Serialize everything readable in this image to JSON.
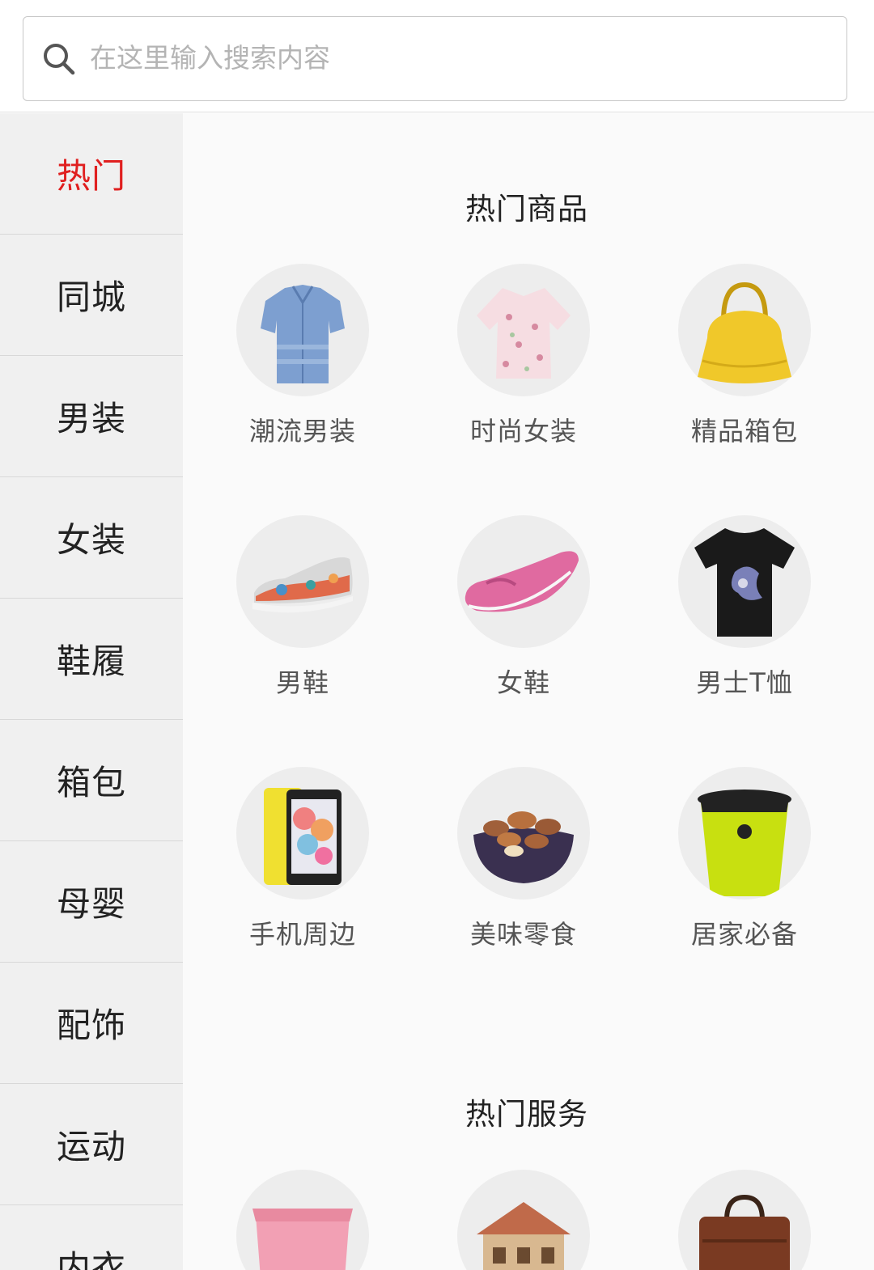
{
  "search": {
    "placeholder": "在这里输入搜索内容",
    "icon": "search-icon"
  },
  "sidebar": {
    "active_color": "#e02020",
    "items": [
      {
        "label": "热门"
      },
      {
        "label": "同城"
      },
      {
        "label": "男装"
      },
      {
        "label": "女装"
      },
      {
        "label": "鞋履"
      },
      {
        "label": "箱包"
      },
      {
        "label": "母婴"
      },
      {
        "label": "配饰"
      },
      {
        "label": "运动"
      },
      {
        "label": "内衣"
      }
    ]
  },
  "sections": {
    "hot_goods": {
      "title": "热门商品",
      "items": [
        {
          "label": "潮流男装",
          "icon": "men-shirt-icon"
        },
        {
          "label": "时尚女装",
          "icon": "women-blouse-icon"
        },
        {
          "label": "精品箱包",
          "icon": "handbag-icon"
        },
        {
          "label": "男鞋",
          "icon": "sneaker-icon"
        },
        {
          "label": "女鞋",
          "icon": "loafer-icon"
        },
        {
          "label": "男士T恤",
          "icon": "tshirt-icon"
        },
        {
          "label": "手机周边",
          "icon": "phone-icon"
        },
        {
          "label": "美味零食",
          "icon": "nuts-bowl-icon"
        },
        {
          "label": "居家必备",
          "icon": "trash-bin-icon"
        }
      ]
    },
    "hot_services": {
      "title": "热门服务",
      "items": [
        {
          "icon": "storage-box-icon"
        },
        {
          "icon": "house-icon"
        },
        {
          "icon": "briefcase-icon"
        }
      ]
    }
  }
}
